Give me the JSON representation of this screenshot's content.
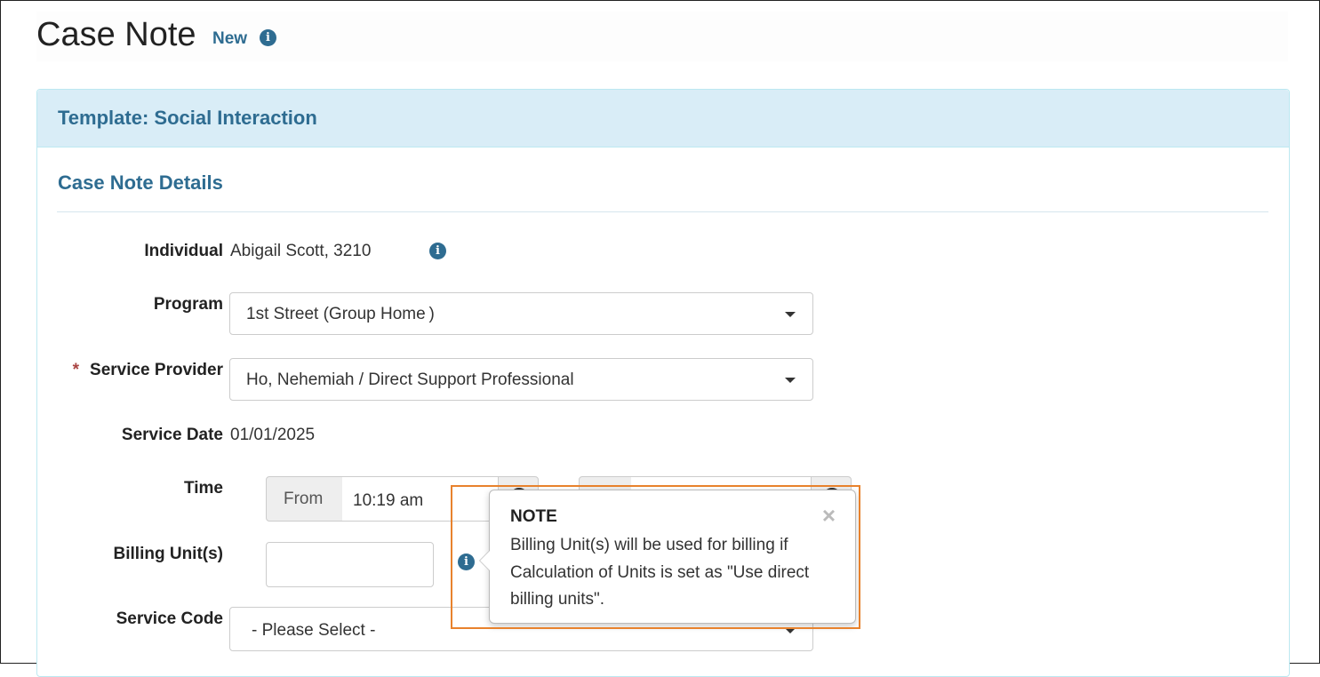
{
  "header": {
    "title": "Case Note",
    "badge": "New",
    "info_icon": "info-circle-icon"
  },
  "panel": {
    "title": "Template: Social Interaction",
    "section_title": "Case Note Details"
  },
  "form": {
    "individual": {
      "label": "Individual",
      "value": "Abigail Scott, 3210"
    },
    "program": {
      "label": "Program",
      "value": "1st Street (Group Home )"
    },
    "service_provider": {
      "label": "Service Provider",
      "required_marker": "*",
      "value": "Ho, Nehemiah / Direct Support Professional"
    },
    "service_date": {
      "label": "Service Date",
      "value": "01/01/2025"
    },
    "time": {
      "label": "Time",
      "from_addon": "From",
      "from_value": "10:19 am",
      "to_addon": "",
      "to_value": ""
    },
    "billing_units": {
      "label": "Billing Unit(s)",
      "value": ""
    },
    "service_code": {
      "label": "Service Code",
      "value": "- Please Select -"
    }
  },
  "popover": {
    "title": "NOTE",
    "body": "Billing Unit(s) will be used for billing if Calculation of Units is set as \"Use direct billing units\".",
    "close_label": "×"
  },
  "colors": {
    "accent": "#2e6c91",
    "panel_heading_bg": "#d9edf7",
    "required": "#a94442",
    "highlight": "#e8822d"
  }
}
